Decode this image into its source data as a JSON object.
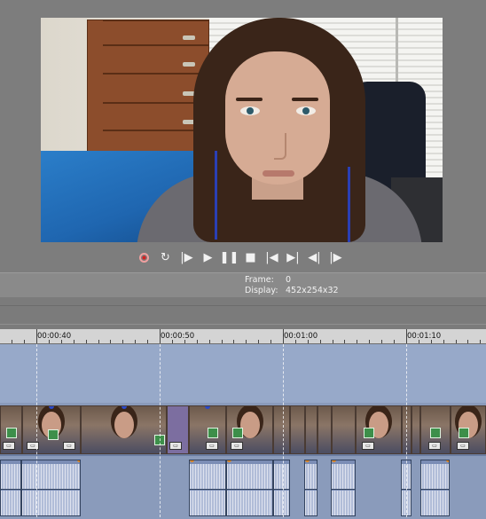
{
  "preview": {
    "frame_label": "Frame:",
    "frame_value": "0",
    "display_label": "Display:",
    "display_value": "452x254x32"
  },
  "transport": [
    {
      "name": "record-button",
      "icon": "record-icon",
      "glyph": ""
    },
    {
      "name": "loop-playback-button",
      "icon": "loop-icon",
      "glyph": "↻"
    },
    {
      "name": "play-from-start-button",
      "icon": "play-from-start-icon",
      "glyph": "|▶"
    },
    {
      "name": "play-button",
      "icon": "play-icon",
      "glyph": "▶"
    },
    {
      "name": "pause-button",
      "icon": "pause-icon",
      "glyph": "❚❚"
    },
    {
      "name": "stop-button",
      "icon": "stop-icon",
      "glyph": "■"
    },
    {
      "name": "go-to-start-button",
      "icon": "go-to-start-icon",
      "glyph": "|◀"
    },
    {
      "name": "go-to-end-button",
      "icon": "go-to-end-icon",
      "glyph": "▶|"
    },
    {
      "name": "previous-frame-button",
      "icon": "previous-frame-icon",
      "glyph": "◀|"
    },
    {
      "name": "next-frame-button",
      "icon": "next-frame-icon",
      "glyph": "|▶"
    }
  ],
  "ruler": {
    "labels": [
      "00:00:40",
      "00:00:50",
      "00:01:00",
      "00:01:10"
    ]
  },
  "colors": {
    "timeline_bg": "#9aaece",
    "ruler_bg": "#d4d4d4",
    "window_bg": "#7d7d7d",
    "record_red": "#d93a3a"
  }
}
